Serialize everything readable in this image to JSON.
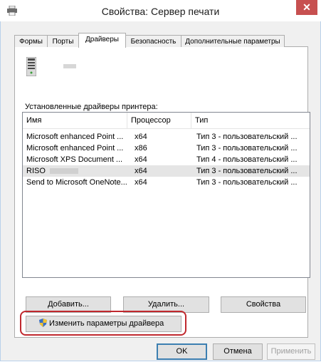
{
  "window": {
    "title": "Свойства: Сервер печати",
    "close_glyph": "✕"
  },
  "tabs": [
    {
      "label": "Формы"
    },
    {
      "label": "Порты"
    },
    {
      "label": "Драйверы"
    },
    {
      "label": "Безопасность"
    },
    {
      "label": "Дополнительные параметры"
    }
  ],
  "drivers": {
    "caption": "Установленные драйверы принтера:",
    "columns": [
      "Имя",
      "Процессор",
      "Тип"
    ],
    "rows": [
      {
        "name": "Microsoft enhanced Point ...",
        "processor": "x64",
        "type": "Тип 3 - пользовательский ..."
      },
      {
        "name": "Microsoft enhanced Point ...",
        "processor": "x86",
        "type": "Тип 3 - пользовательский ..."
      },
      {
        "name": "Microsoft XPS Document ...",
        "processor": "x64",
        "type": "Тип 4 - пользовательский ..."
      },
      {
        "name": "RISO",
        "processor": "x64",
        "type": "Тип 3 - пользовательский ..."
      },
      {
        "name": "Send to Microsoft OneNote...",
        "processor": "x64",
        "type": "Тип 3 - пользовательский ..."
      }
    ]
  },
  "buttons": {
    "add": "Добавить...",
    "remove": "Удалить...",
    "properties": "Свойства",
    "change_settings": "Изменить параметры драйвера",
    "ok": "OK",
    "cancel": "Отмена",
    "apply": "Применить"
  },
  "colors": {
    "highlight": "#c0282e",
    "close_button": "#c75050",
    "selected_row": "#e5e5e5"
  },
  "icons": [
    "printer-icon",
    "server-icon",
    "uac-shield-icon"
  ]
}
